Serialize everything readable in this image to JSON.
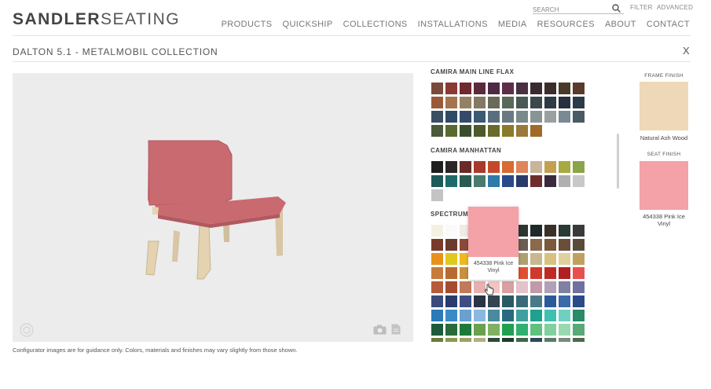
{
  "brand": {
    "part1": "SANDLER",
    "part2": "SEATING"
  },
  "top": {
    "search_placeholder": "SEARCH",
    "filter": "FILTER",
    "advanced": "ADVANCED"
  },
  "nav": [
    "PRODUCTS",
    "QUICKSHIP",
    "COLLECTIONS",
    "INSTALLATIONS",
    "MEDIA",
    "RESOURCES",
    "ABOUT",
    "CONTACT"
  ],
  "page_title": "DALTON 5.1 - METALMOBIL COLLECTION",
  "close_label": "X",
  "disclaimer": "Configurator images are for guidance only. Colors, materials and finishes may vary slightly from those shown.",
  "sections": [
    {
      "title": "CAMIRA MAIN LINE FLAX",
      "colors": [
        "#7a4a3a",
        "#8a3a32",
        "#6e2a2e",
        "#5a2a3a",
        "#4e2a44",
        "#5e2e48",
        "#4a3040",
        "#3a2a2e",
        "#3a2e2a",
        "#4a3a2a",
        "#5a3a2a",
        "#9a5a3a",
        "#a4744e",
        "#948064",
        "#847a64",
        "#6a6a5a",
        "#5a6a5a",
        "#4a5a54",
        "#3a4a4a",
        "#2e3a44",
        "#26303e",
        "#2a3a48",
        "#3a4e64",
        "#2e4a64",
        "#344a6a",
        "#3a5a74",
        "#5a6e80",
        "#6a7a84",
        "#7a8a8a",
        "#8a9494",
        "#9aa0a0",
        "#7a8a94",
        "#4a5a64",
        "#4a5a3a",
        "#5a6a2e",
        "#3a4e2e",
        "#4e5a2a",
        "#6a6a2a",
        "#8a7a2a",
        "#9a7a3a",
        "#a06a2a"
      ]
    },
    {
      "title": "CAMIRA MANHATTAN",
      "colors": [
        "#1e1e1e",
        "#2a2624",
        "#6a2a26",
        "#a83a2a",
        "#c24a2a",
        "#d86a34",
        "#e0845a",
        "#cab49a",
        "#c2a050",
        "#a6aa40",
        "#8aa448",
        "#1e5a5a",
        "#1e6a6a",
        "#2a5a54",
        "#4a7a6e",
        "#2e7aaa",
        "#2a4a8a",
        "#2a3a6a",
        "#6e2e2e",
        "#3a2a3e",
        "#b0b0b0",
        "#c8c8c8",
        "#c4c4c4"
      ]
    },
    {
      "title": "SPECTRUM",
      "colors": [
        "#f4f0e2",
        "#fafafa",
        "#f0ece4",
        "#e8e4dc",
        "#2a2e2a",
        "#3a3a34",
        "#2e3632",
        "#1e2a2a",
        "#3a3028",
        "#2a3a34",
        "#3a3a3a",
        "#7a3a2a",
        "#6a3a2e",
        "#8a4a3a",
        "#4a4a4a",
        "#5a5a5a",
        "#5e564a",
        "#6a5e50",
        "#8a6a4a",
        "#7a5a3a",
        "#6a4e3a",
        "#5a4a3a",
        "#e8921a",
        "#e0c820",
        "#f0b820",
        "#d8c89a",
        "#c89a50",
        "#a8b030",
        "#b0a070",
        "#c8b890",
        "#d8c080",
        "#e0d0a0",
        "#c0a060",
        "#c87a3a",
        "#b86a30",
        "#c89040",
        "#d2a050",
        "#a87a3a",
        "#986a30",
        "#e05030",
        "#d03a2a",
        "#c02a26",
        "#b02020",
        "#e85050",
        "#b85a3a",
        "#a64a30",
        "#c07a5a",
        "#e8b0b0",
        "#f4c4c4",
        "#d8a0a0",
        "#e4c2c8",
        "#c09aaa",
        "#b0a0b8",
        "#8080a0",
        "#7070a0",
        "#3a4a7a",
        "#2a3a6a",
        "#3e4e84",
        "#2a3444",
        "#344450",
        "#2a5a64",
        "#3a6a7a",
        "#4a7a8a",
        "#2a5a9a",
        "#3a6aaa",
        "#2a4a8a",
        "#2a7ab8",
        "#3a8ac8",
        "#6aa0d0",
        "#8ab8e0",
        "#4a8aa0",
        "#2a6a80",
        "#40a0a0",
        "#20a090",
        "#40c0b0",
        "#70d0c0",
        "#2a8a6a",
        "#1e5a3a",
        "#2a6a3a",
        "#1e7a3a",
        "#6aa050",
        "#80b060",
        "#20a050",
        "#30b070",
        "#60c080",
        "#80d0a0",
        "#9ad8b0",
        "#58a878",
        "#6a7a3a",
        "#8a9a4a",
        "#a0a060",
        "#b0b080",
        "#2a4a3a",
        "#1e3a2a",
        "#3a6a4a",
        "#2a4a5a",
        "#5a7a6a",
        "#7a8a7a",
        "#4a6a4a"
      ]
    }
  ],
  "tooltip": {
    "label": "454338 Pink Ice Vinyl"
  },
  "frame_finish": {
    "heading": "FRAME FINISH",
    "name": "Natural Ash Wood",
    "color": "#eed8b8"
  },
  "seat_finish": {
    "heading": "SEAT FINISH",
    "name": "454338 Pink Ice Vinyl",
    "color": "#f4a1a8"
  },
  "colors": {
    "chair_fabric": "#c96a70",
    "chair_wood": "#e4d2b0",
    "viewer_bg": "#ececec"
  },
  "icons": {
    "viewer_left": "rotate-icon",
    "camera": "camera-icon",
    "doc": "document-icon"
  }
}
